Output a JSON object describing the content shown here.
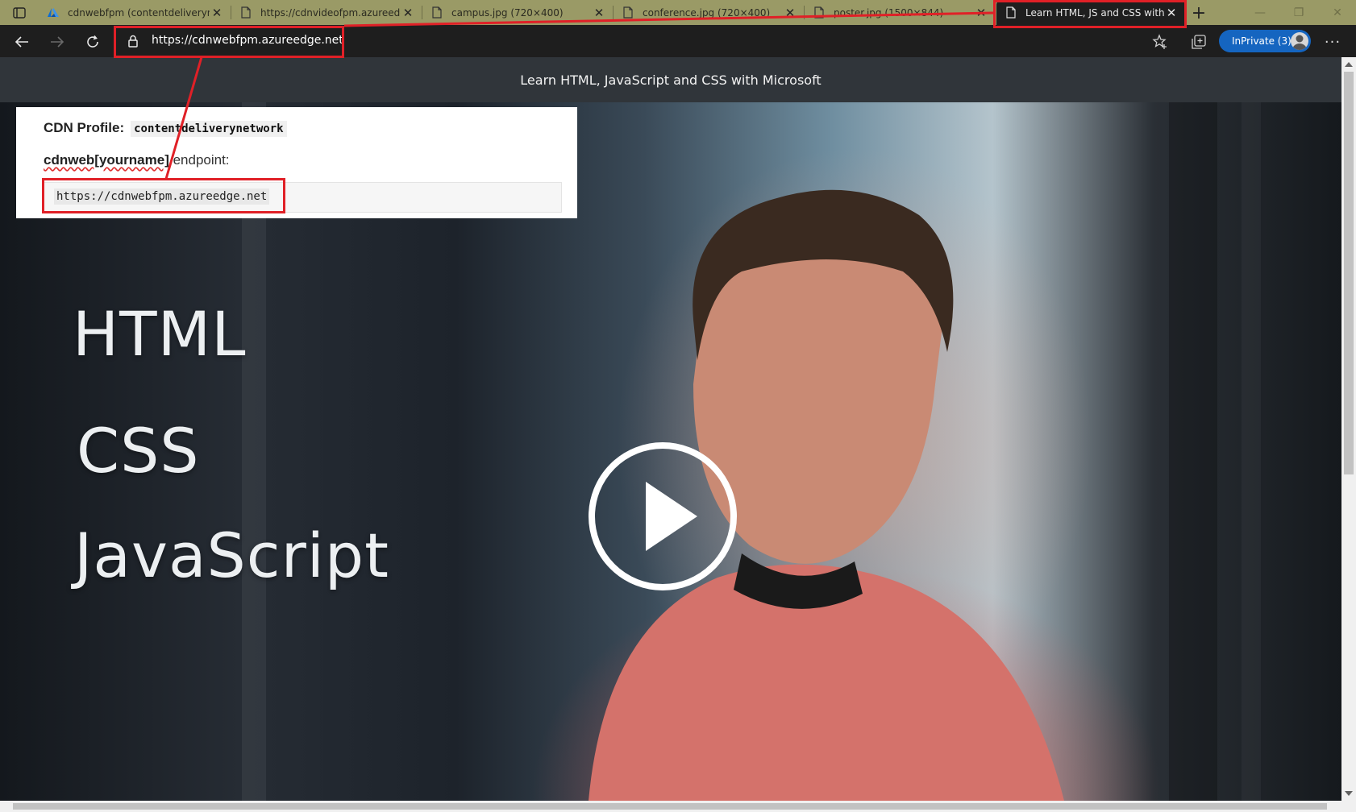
{
  "browser": {
    "tabs": [
      {
        "title": "cdnwebfpm (contentdeliverynet",
        "icon": "azure-icon"
      },
      {
        "title": "https://cdnvideofpm.azureedge",
        "icon": "page-icon"
      },
      {
        "title": "campus.jpg (720×400)",
        "icon": "page-icon"
      },
      {
        "title": "conference.jpg (720×400)",
        "icon": "page-icon"
      },
      {
        "title": "poster.jpg (1500×844)",
        "icon": "page-icon"
      },
      {
        "title": "Learn HTML, JS and CSS with Mi",
        "icon": "page-icon",
        "active": true
      }
    ],
    "address": "https://cdnwebfpm.azureedge.net",
    "inprivate_label": "InPrivate (3)"
  },
  "page": {
    "header_title": "Learn HTML, JavaScript and CSS with Microsoft",
    "video_words": [
      "HTML",
      "CSS",
      "JavaScript"
    ]
  },
  "snippet": {
    "cdn_profile_label": "CDN Profile:",
    "cdn_profile_value": "contentdeliverynetwork",
    "endpoint_name": "cdnweb[yourname]",
    "endpoint_suffix": " endpoint:",
    "endpoint_url": "https://cdnwebfpm.azureedge.net"
  },
  "colors": {
    "annotation": "#e02027",
    "inprivate": "#1565c0",
    "tabstrip": "#9a9a66"
  }
}
